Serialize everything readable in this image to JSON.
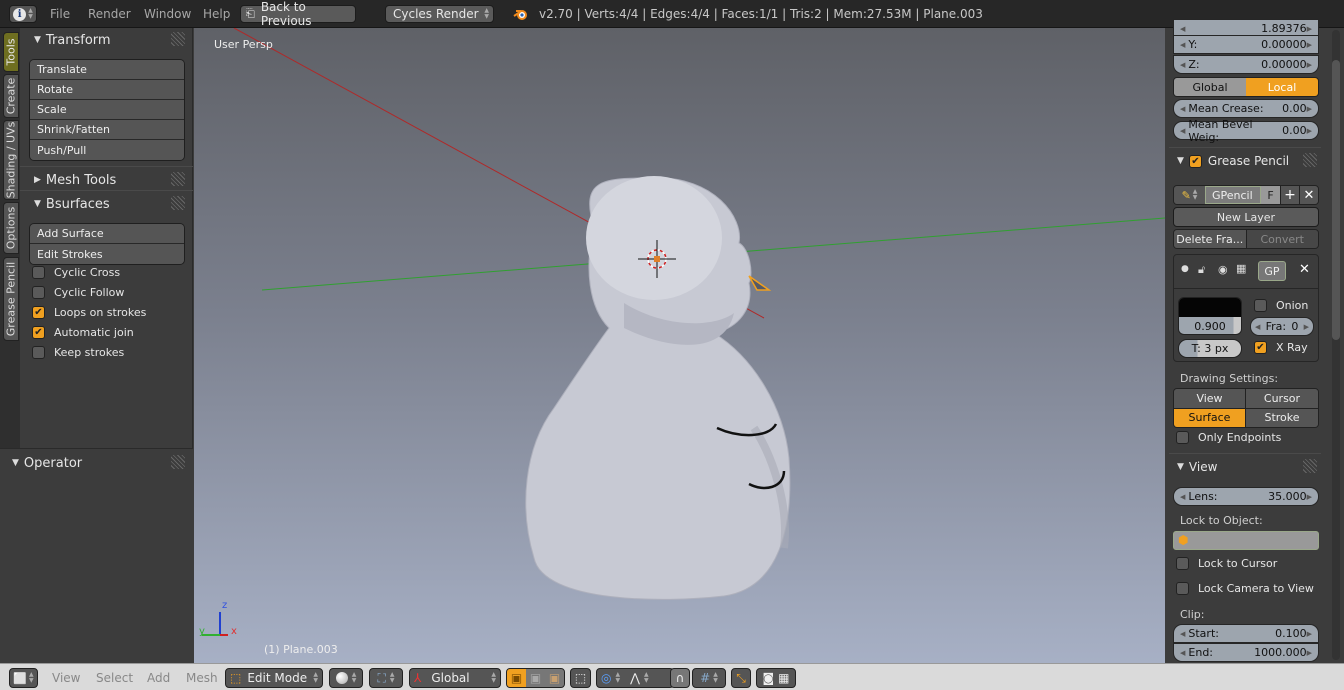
{
  "topbar": {
    "info_icon": "info-icon",
    "menus": [
      "File",
      "Render",
      "Window",
      "Help"
    ],
    "back_button": "Back to Previous",
    "render_engine": "Cycles Render",
    "stats": "v2.70 | Verts:4/4 | Edges:4/4 | Faces:1/1 | Tris:2 | Mem:27.53M | Plane.003"
  },
  "tabs": [
    "Tools",
    "Create",
    "Shading / UVs",
    "Options",
    "Grease Pencil"
  ],
  "toolshelf": {
    "transform": {
      "title": "Transform",
      "buttons": [
        "Translate",
        "Rotate",
        "Scale",
        "Shrink/Fatten",
        "Push/Pull"
      ]
    },
    "mesh_tools": {
      "title": "Mesh Tools"
    },
    "bsurfaces": {
      "title": "Bsurfaces",
      "buttons": [
        "Add Surface",
        "Edit Strokes"
      ],
      "checks": [
        {
          "label": "Cyclic Cross",
          "checked": false
        },
        {
          "label": "Cyclic Follow",
          "checked": false
        },
        {
          "label": "Loops on strokes",
          "checked": true
        },
        {
          "label": "Automatic join",
          "checked": true
        },
        {
          "label": "Keep strokes",
          "checked": false
        }
      ]
    }
  },
  "operator": {
    "title": "Operator"
  },
  "viewport": {
    "view_name": "User Persp",
    "object_label": "(1) Plane.003",
    "axes": {
      "x": "x",
      "y": "y",
      "z": "z"
    }
  },
  "properties": {
    "x_partial": "1.89376",
    "y": {
      "label": "Y:",
      "value": "0.00000"
    },
    "z": {
      "label": "Z:",
      "value": "0.00000"
    },
    "space": {
      "options": [
        "Global",
        "Local"
      ],
      "selected": "Local"
    },
    "mean_crease": {
      "label": "Mean Crease:",
      "value": "0.00"
    },
    "mean_bevel": {
      "label": "Mean Bevel Weig:",
      "value": "0.00"
    },
    "grease_pencil": {
      "title": "Grease Pencil",
      "enabled": true,
      "datablock": "GPencil",
      "fake_user": "F",
      "new_layer": "New Layer",
      "delete_frame": "Delete Fra...",
      "convert": "Convert",
      "layer_name": "GP",
      "opacity": "0.900",
      "thickness": "T: 3 px",
      "onion": {
        "label": "Onion",
        "checked": false
      },
      "frames": {
        "label": "Fra:",
        "value": "0"
      },
      "xray": {
        "label": "X Ray",
        "checked": true
      },
      "drawing_settings_label": "Drawing Settings:",
      "drawing_modes": [
        "View",
        "Cursor",
        "Surface",
        "Stroke"
      ],
      "drawing_selected": "Surface",
      "only_endpoints": {
        "label": "Only Endpoints",
        "checked": false
      }
    },
    "view": {
      "title": "View",
      "lens": {
        "label": "Lens:",
        "value": "35.000"
      },
      "lock_to_object_label": "Lock to Object:",
      "lock_to_cursor": {
        "label": "Lock to Cursor",
        "checked": false
      },
      "lock_camera": {
        "label": "Lock Camera to View",
        "checked": false
      },
      "clip_label": "Clip:",
      "clip_start": {
        "label": "Start:",
        "value": "0.100"
      },
      "clip_end": {
        "label": "End:",
        "value": "1000.000"
      }
    }
  },
  "bottombar": {
    "menus": [
      "View",
      "Select",
      "Add",
      "Mesh"
    ],
    "mode": "Edit Mode",
    "orientation": "Global"
  },
  "colors": {
    "accent": "#f0a020",
    "x_axis": "#c03030",
    "y_axis": "#40b040",
    "z_axis": "#3050d0"
  }
}
